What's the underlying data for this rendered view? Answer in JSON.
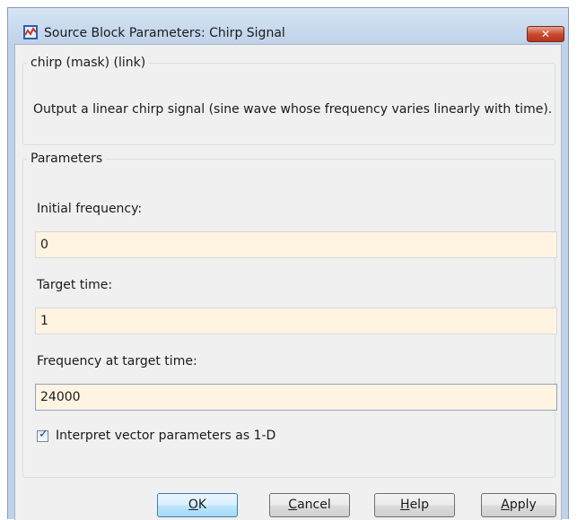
{
  "window": {
    "title": "Source Block Parameters: Chirp Signal",
    "close_symbol": "✕"
  },
  "description_group": {
    "legend": "chirp (mask) (link)",
    "text": "Output a linear chirp signal (sine wave  whose frequency varies linearly with time)."
  },
  "parameters_group": {
    "legend": "Parameters",
    "fields": [
      {
        "label": "Initial frequency:",
        "value": "0"
      },
      {
        "label": "Target time:",
        "value": "1"
      },
      {
        "label": "Frequency at target time:",
        "value": "24000"
      }
    ],
    "checkbox": {
      "label": "Interpret vector parameters as 1-D",
      "checked": true
    }
  },
  "buttons": {
    "ok": {
      "mnemonic": "O",
      "rest": "K"
    },
    "cancel": {
      "mnemonic": "C",
      "rest": "ancel"
    },
    "help": {
      "mnemonic": "H",
      "rest": "elp"
    },
    "apply": {
      "mnemonic": "A",
      "rest": "pply"
    }
  },
  "colors": {
    "input_background": "#fff4e2",
    "title_bar": "#bfd2e9",
    "close_button": "#c7452b"
  },
  "icons": [
    "simulink-block-icon",
    "close-icon",
    "checkmark-icon"
  ]
}
